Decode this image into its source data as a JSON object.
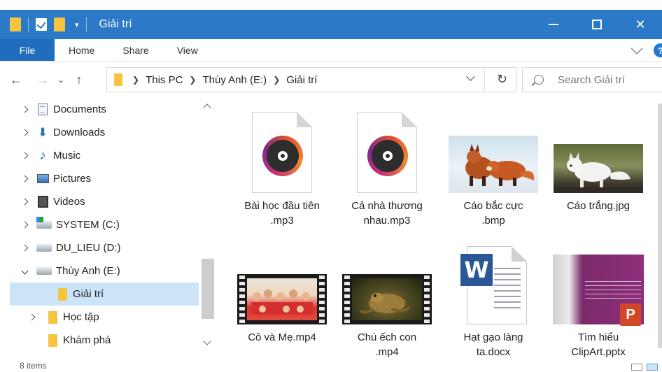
{
  "window": {
    "title": "Giải trí"
  },
  "ribbon": {
    "tabs": [
      "File",
      "Home",
      "Share",
      "View"
    ]
  },
  "address": {
    "crumbs": [
      "This PC",
      "Thùy Anh (E:)",
      "Giải trí"
    ]
  },
  "search": {
    "placeholder": "Search Giải trí"
  },
  "nav": {
    "items": [
      {
        "label": "Documents"
      },
      {
        "label": "Downloads"
      },
      {
        "label": "Music"
      },
      {
        "label": "Pictures"
      },
      {
        "label": "Videos"
      },
      {
        "label": "SYSTEM (C:)"
      },
      {
        "label": "DU_LIEU (D:)"
      },
      {
        "label": "Thùy Anh (E:)"
      },
      {
        "label": "Giải trí"
      },
      {
        "label": "Học tập"
      },
      {
        "label": "Khám phá"
      }
    ]
  },
  "files": [
    {
      "line1": "Bài học đầu tiên",
      "line2": ".mp3"
    },
    {
      "line1": "Cả nhà thương",
      "line2": "nhau.mp3"
    },
    {
      "line1": "Cáo bắc cực",
      "line2": ".bmp"
    },
    {
      "line1": "Cáo trắng.jpg",
      "line2": ""
    },
    {
      "line1": "Cô và Mẹ.mp4",
      "line2": ""
    },
    {
      "line1": "Chú ếch con",
      "line2": ".mp4"
    },
    {
      "line1": "Hạt gạo làng",
      "line2": "ta.docx"
    },
    {
      "line1": "Tìm hiểu",
      "line2": "ClipArt.pptx"
    }
  ],
  "status": {
    "text": "8 items"
  },
  "colors": {
    "titlebar": "#2b79c7",
    "file_tab": "#1f6dbd",
    "selection": "#cce4f7",
    "folder": "#f5c542"
  }
}
